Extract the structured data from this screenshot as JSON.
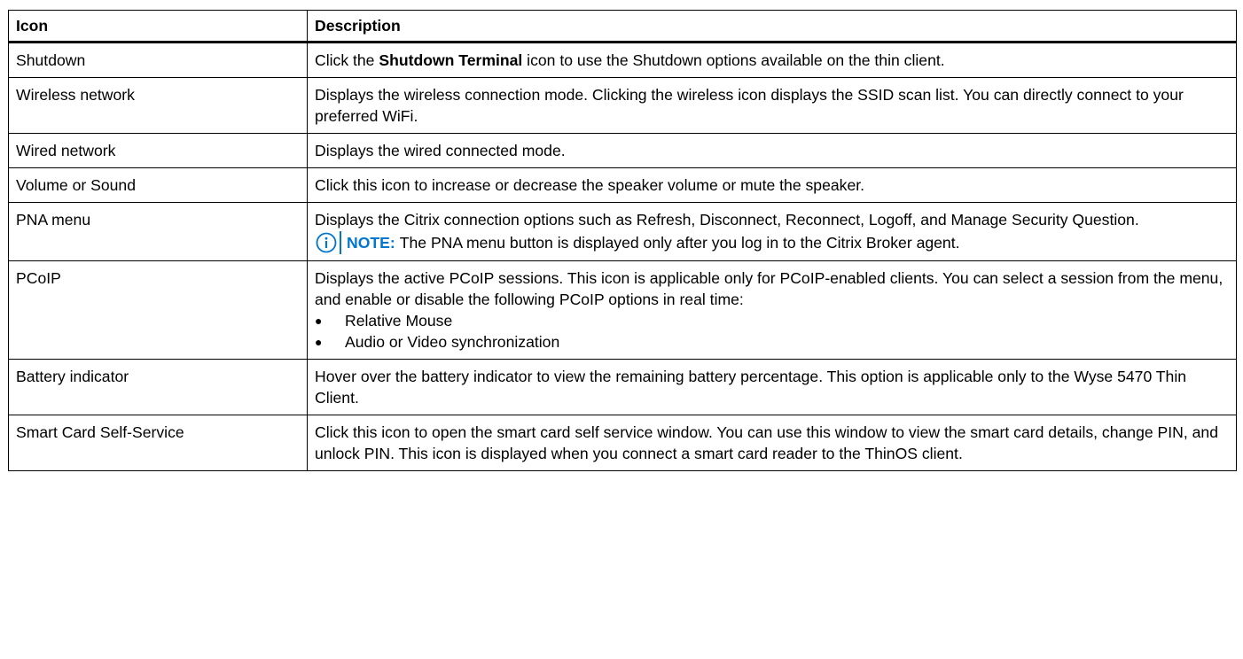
{
  "table": {
    "header": {
      "col1": "Icon",
      "col2": "Description"
    },
    "rows": [
      {
        "icon": "Shutdown",
        "desc_pre": "Click the ",
        "desc_bold": "Shutdown Terminal",
        "desc_post": " icon to use the Shutdown options available on the thin client."
      },
      {
        "icon": "Wireless network",
        "desc": "Displays the wireless connection mode. Clicking the wireless icon displays the SSID scan list. You can directly connect to your preferred WiFi."
      },
      {
        "icon": "Wired network",
        "desc": "Displays the wired connected mode."
      },
      {
        "icon": "Volume or Sound",
        "desc": "Click this icon to increase or decrease the speaker volume or mute the speaker."
      },
      {
        "icon": "PNA menu",
        "desc": "Displays the Citrix connection options such as Refresh, Disconnect, Reconnect, Logoff, and Manage Security Question.",
        "note_label": "NOTE:",
        "note_text": "The PNA menu button is displayed only after you log in to the Citrix Broker agent.",
        "note_icon": "info-icon"
      },
      {
        "icon": "PCoIP",
        "desc": "Displays the active PCoIP sessions. This icon is applicable only for PCoIP-enabled clients. You can select a session from the menu, and enable or disable the following PCoIP options in real time:",
        "bullets": [
          "Relative Mouse",
          "Audio or Video synchronization"
        ]
      },
      {
        "icon": "Battery indicator",
        "desc": "Hover over the battery indicator to view the remaining battery percentage. This option is applicable only to the Wyse 5470 Thin Client."
      },
      {
        "icon": "Smart Card Self-Service",
        "desc": "Click this icon to open the smart card self service window. You can use this window to view the smart card details, change PIN, and unlock PIN. This icon is displayed when you connect a smart card reader to the ThinOS client."
      }
    ]
  },
  "colors": {
    "note_accent": "#0076ce",
    "border": "#000000",
    "text": "#000000"
  }
}
